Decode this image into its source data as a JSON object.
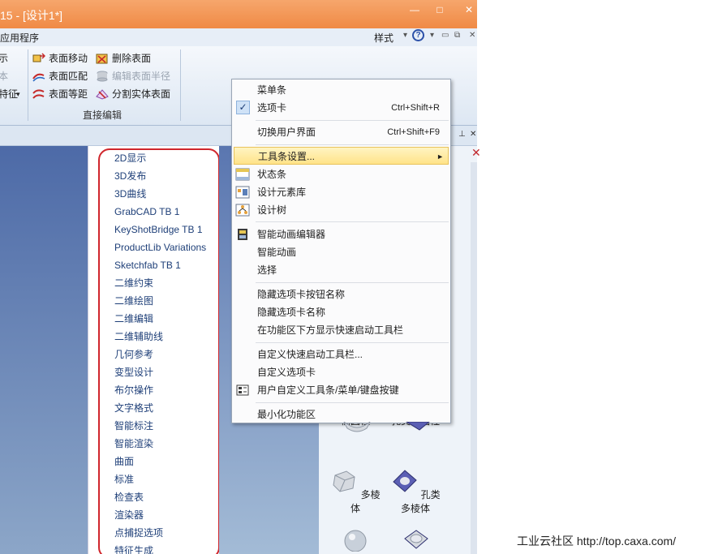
{
  "window": {
    "title": "15 - [设计1*]",
    "min_label": "—",
    "max_label": "□",
    "close_label": "✕"
  },
  "menubar": {
    "app_menu": "应用程序",
    "style_label": "样式",
    "help_label": "?"
  },
  "ribbon": {
    "left_partial": [
      "示",
      "本",
      "特征"
    ],
    "items": {
      "surface_move": "表面移动",
      "surface_match": "表面匹配",
      "surface_offset": "表面等距",
      "delete_surface": "删除表面",
      "edit_surface_radius": "编辑表面半径",
      "split_solid_surface": "分割实体表面"
    },
    "group_label": "直接编辑"
  },
  "toolbar_list": [
    "2D显示",
    "3D发布",
    "3D曲线",
    "GrabCAD TB 1",
    "KeyShotBridge TB 1",
    "ProductLib Variations",
    "Sketchfab TB 1",
    "二维约束",
    "二维绘图",
    "二维编辑",
    "二维辅助线",
    "几何参考",
    "变型设计",
    "布尔操作",
    "文字格式",
    "智能标注",
    "智能渲染",
    "曲面",
    "标准",
    "检查表",
    "渲染器",
    "点捕捉选项",
    "特征生成"
  ],
  "context_menu": {
    "menubar": "菜单条",
    "tabs": "选项卡",
    "tabs_shortcut": "Ctrl+Shift+R",
    "switch_ui": "切换用户界面",
    "switch_ui_shortcut": "Ctrl+Shift+F9",
    "toolbar_settings": "工具条设置...",
    "status_bar": "状态条",
    "design_library": "设计元素库",
    "design_tree": "设计树",
    "anim_editor": "智能动画编辑器",
    "smart_anim": "智能动画",
    "select": "选择",
    "hide_tab_button_names": "隐藏选项卡按钮名称",
    "hide_tab_names": "隐藏选项卡名称",
    "show_qat_below": "在功能区下方显示快速启动工具栏",
    "customize_qat": "自定义快速启动工具栏...",
    "customize_tabs": "自定义选项卡",
    "customize_user": "用户自定义工具条/菜单/键盘按键",
    "minimize_ribbon": "最小化功能区"
  },
  "design_panel": {
    "items": [
      "椭圆柱",
      "孔类椭圆柱",
      "多棱体",
      "孔类多棱体"
    ]
  },
  "watermark": "工业云社区 http://top.caxa.com/",
  "colors": {
    "title_bar": "#f08a45",
    "highlight": "#ffe389",
    "annotation_oval": "#d0262c"
  }
}
